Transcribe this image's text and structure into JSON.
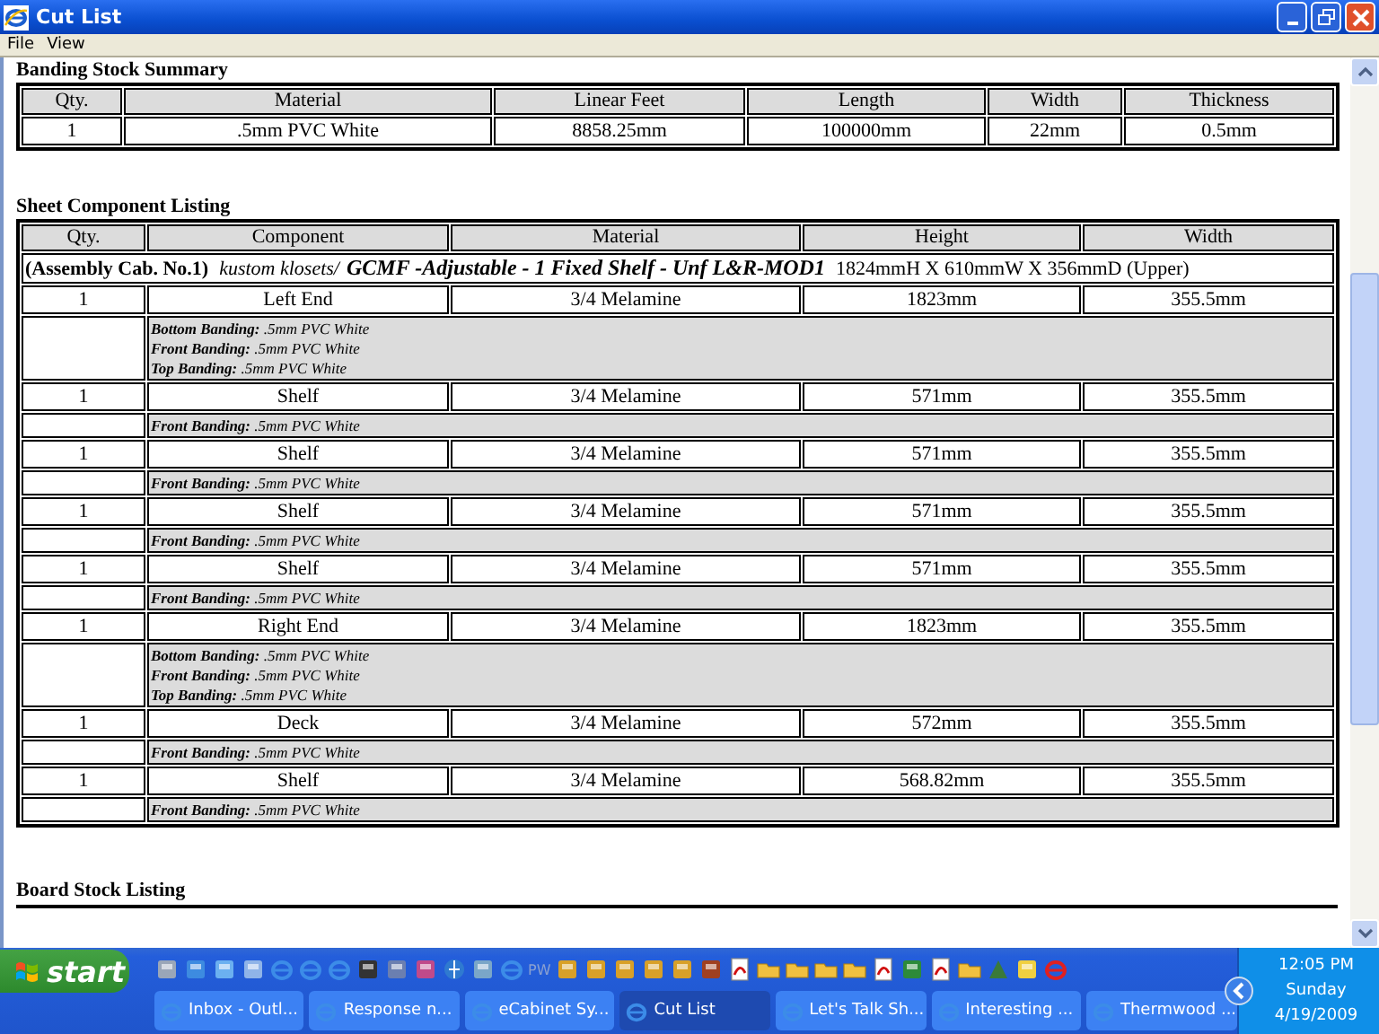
{
  "window": {
    "title": "Cut List"
  },
  "menu": [
    "File",
    "View"
  ],
  "banding_summary": {
    "title": "Banding Stock Summary",
    "columns": [
      "Qty.",
      "Material",
      "Linear Feet",
      "Length",
      "Width",
      "Thickness"
    ],
    "rows": [
      [
        "1",
        ".5mm PVC White",
        "8858.25mm",
        "100000mm",
        "22mm",
        "0.5mm"
      ]
    ]
  },
  "sheet_listing": {
    "title": "Sheet Component Listing",
    "columns": [
      "Qty.",
      "Component",
      "Material",
      "Height",
      "Width"
    ],
    "assembly": {
      "label": "(Assembly Cab. No.1)",
      "vendor": "kustom klosets/",
      "name": "GCMF -Adjustable - 1 Fixed Shelf - Unf L&R-MOD1",
      "dimensions": "1824mmH X 610mmW X 356mmD  (Upper)"
    },
    "rows": [
      {
        "qty": "1",
        "component": "Left End",
        "material": "3/4 Melamine",
        "height": "1823mm",
        "width": "355.5mm",
        "banding": [
          {
            "label": "Bottom Banding:",
            "value": ".5mm PVC White"
          },
          {
            "label": "Front Banding:",
            "value": ".5mm PVC White"
          },
          {
            "label": "Top Banding:",
            "value": ".5mm PVC White"
          }
        ]
      },
      {
        "qty": "1",
        "component": "Shelf",
        "material": "3/4 Melamine",
        "height": "571mm",
        "width": "355.5mm",
        "banding": [
          {
            "label": "Front Banding:",
            "value": ".5mm PVC White"
          }
        ]
      },
      {
        "qty": "1",
        "component": "Shelf",
        "material": "3/4 Melamine",
        "height": "571mm",
        "width": "355.5mm",
        "banding": [
          {
            "label": "Front Banding:",
            "value": ".5mm PVC White"
          }
        ]
      },
      {
        "qty": "1",
        "component": "Shelf",
        "material": "3/4 Melamine",
        "height": "571mm",
        "width": "355.5mm",
        "banding": [
          {
            "label": "Front Banding:",
            "value": ".5mm PVC White"
          }
        ]
      },
      {
        "qty": "1",
        "component": "Shelf",
        "material": "3/4 Melamine",
        "height": "571mm",
        "width": "355.5mm",
        "banding": [
          {
            "label": "Front Banding:",
            "value": ".5mm PVC White"
          }
        ]
      },
      {
        "qty": "1",
        "component": "Right End",
        "material": "3/4 Melamine",
        "height": "1823mm",
        "width": "355.5mm",
        "banding": [
          {
            "label": "Bottom Banding:",
            "value": ".5mm PVC White"
          },
          {
            "label": "Front Banding:",
            "value": ".5mm PVC White"
          },
          {
            "label": "Top Banding:",
            "value": ".5mm PVC White"
          }
        ]
      },
      {
        "qty": "1",
        "component": "Deck",
        "material": "3/4 Melamine",
        "height": "572mm",
        "width": "355.5mm",
        "banding": [
          {
            "label": "Front Banding:",
            "value": ".5mm PVC White"
          }
        ]
      },
      {
        "qty": "1",
        "component": "Shelf",
        "material": "3/4 Melamine",
        "height": "568.82mm",
        "width": "355.5mm",
        "banding": [
          {
            "label": "Front Banding:",
            "value": ".5mm PVC White"
          }
        ]
      }
    ]
  },
  "board_listing": {
    "title": "Board Stock Listing"
  },
  "taskbar": {
    "start_label": "start",
    "quick_launch_text": "PW",
    "buttons": [
      {
        "label": "Inbox - Outl...",
        "selected": false
      },
      {
        "label": "Response n...",
        "selected": false
      },
      {
        "label": "eCabinet Sy...",
        "selected": false
      },
      {
        "label": "Cut List",
        "selected": true
      },
      {
        "label": "Let's Talk Sh...",
        "selected": false
      },
      {
        "label": "Interesting ...",
        "selected": false
      },
      {
        "label": "Thermwood ...",
        "selected": false
      }
    ],
    "clock": {
      "time": "12:05 PM",
      "day": "Sunday",
      "date": "4/19/2009"
    }
  }
}
